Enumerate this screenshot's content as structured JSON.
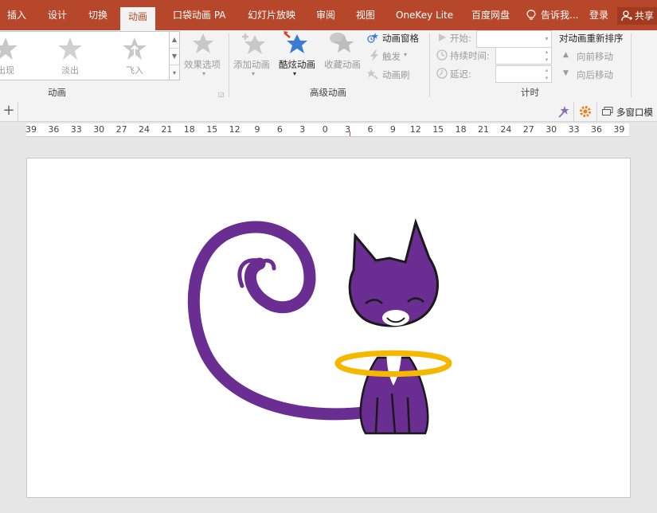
{
  "tabs": {
    "insert": "插入",
    "design": "设计",
    "transitions": "切换",
    "animations": "动画",
    "pocket_animation": "口袋动画 PA",
    "slideshow": "幻灯片放映",
    "review": "审阅",
    "view": "视图",
    "onekey": "OneKey Lite",
    "baidu": "百度网盘",
    "tell_me": "告诉我...",
    "login": "登录",
    "share": "共享"
  },
  "gallery": {
    "items": [
      "出现",
      "淡出",
      "飞入"
    ]
  },
  "ribbon": {
    "effect_options": "效果选项",
    "add_animation": "添加动画",
    "cool_animation": "酷炫动画",
    "favorite_animation": "收藏动画",
    "animation_pane": "动画窗格",
    "trigger": "触发",
    "animation_painter": "动画刷",
    "start_label": "开始:",
    "duration_label": "持续时间:",
    "delay_label": "延迟:",
    "reorder_title": "对动画重新排序",
    "move_earlier": "向前移动",
    "move_later": "向后移动",
    "group_animation": "动画",
    "group_advanced": "高级动画",
    "group_timing": "计时"
  },
  "subbar": {
    "multi_window": "多窗口模"
  },
  "ruler": {
    "ticks": [
      "39",
      "36",
      "33",
      "30",
      "27",
      "24",
      "21",
      "18",
      "15",
      "12",
      "9",
      "6",
      "3",
      "0",
      "3",
      "6",
      "9",
      "12",
      "15",
      "18",
      "21",
      "24",
      "27",
      "30",
      "33",
      "36",
      "39"
    ]
  },
  "colors": {
    "accent": "#b7472a",
    "cat_purple": "#6a2d91",
    "halo": "#f5b800",
    "star_blue": "#3a7bd5"
  }
}
